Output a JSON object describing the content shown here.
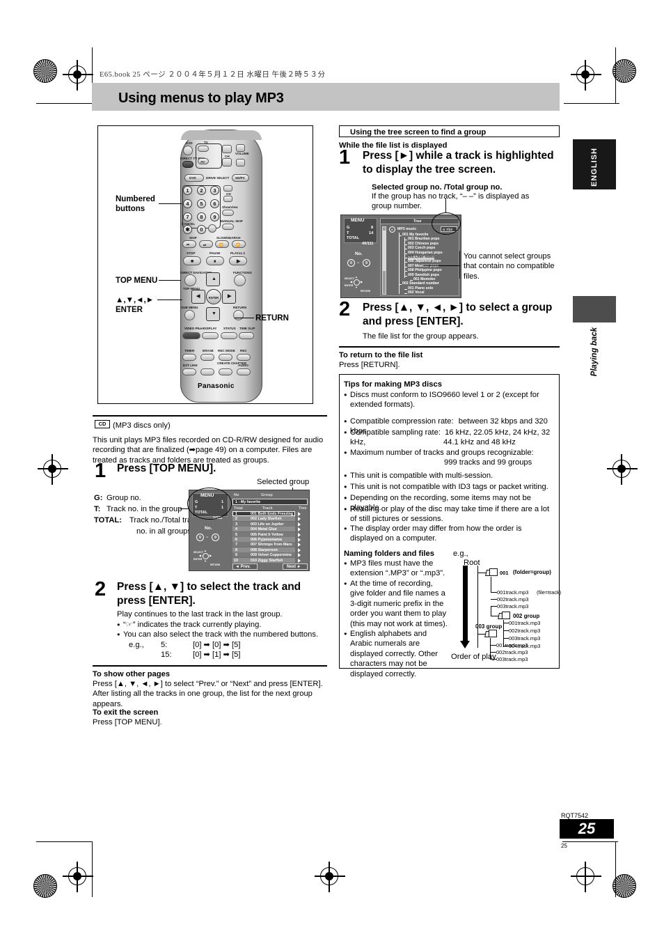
{
  "meta": {
    "bookline": "E65.book  25 ページ  ２００４年５月１２日  水曜日  午後２時５３分",
    "page_title": "Using menus to play MP3",
    "manual_code": "RQT7542",
    "page_number": "25",
    "page_number_small": "25",
    "side_tab_language": "ENGLISH",
    "side_tab_section": "Playing back"
  },
  "remote": {
    "labels": {
      "dvd": "DVD",
      "tv": "TV",
      "direct_tv_rec": "DIRECT TV REC",
      "av": "AV",
      "ch": "CH",
      "volume": "VOLUME",
      "drive_select": "DRIVE SELECT",
      "dvd_btn": "DVD",
      "sd_pc": "SD/PC",
      "showview": "ShowView",
      "cancel": "CANCEL",
      "manual_skip": "MANUAL SKIP",
      "skip": "SKIP",
      "slow_search": "SLOW/SEARCH",
      "stop": "STOP",
      "pause": "PAUSE",
      "play": "PLAYx1.3",
      "direct_navigator": "DIRECT NAVIGATOR",
      "top_menu": "TOP MENU",
      "functions": "FUNCTIONS",
      "enter": "ENTER",
      "sub_menu": "SUB MENU",
      "return": "RETURN",
      "videoplus": "VIDEO Plus+",
      "display": "DISPLAY",
      "status": "STATUS",
      "time_slip": "TIME SLIP",
      "timer": "TIMER",
      "erase": "ERASE",
      "rec_mode": "REC MODE",
      "rec": "REC",
      "ext_link": "EXT LINK",
      "create_chapter": "CREATE CHAPTER",
      "audio": "AUDIO",
      "brand": "Panasonic"
    },
    "number_keys": [
      "1",
      "2",
      "3",
      "4",
      "5",
      "6",
      "7",
      "8",
      "9",
      "0"
    ],
    "callouts": {
      "numbered_buttons": "Numbered\nbuttons",
      "top_menu": "TOP MENU",
      "arrows_enter": "▲,▼,◄,►\nENTER",
      "return": "RETURN"
    }
  },
  "left_column": {
    "cd_tag": "CD",
    "cd_note": "(MP3 discs only)",
    "intro": "This unit plays MP3 files recorded on CD-R/RW designed for audio recording that are finalized (➡page 49) on a computer. Files are treated as tracks and folders are treated as groups.",
    "step1_num": "1",
    "step1_head": "Press [TOP MENU].",
    "selected_group_caption": "Selected group",
    "legend": [
      {
        "key": "G:",
        "text": "Group no."
      },
      {
        "key": "T:",
        "text": "Track no. in the group"
      },
      {
        "key": "TOTAL:",
        "text": "Track no./Total track"
      },
      {
        "key": "",
        "text": "no. in all groups"
      }
    ],
    "step2_num": "2",
    "step2_head": "Press [▲, ▼] to select the track and press [ENTER].",
    "step2_body": "Play continues to the last track in the last group.",
    "step2_bullets": [
      "“☞” indicates the track currently playing.",
      "You can also select the track with the numbered buttons."
    ],
    "eg_label": "e.g.,",
    "eg_rows": [
      {
        "n": "5:",
        "seq": "[0] ➡ [0] ➡ [5]"
      },
      {
        "n": "15:",
        "seq": "[0] ➡ [1] ➡ [5]"
      }
    ],
    "other_pages_head": "To show other pages",
    "other_pages_body": "Press [▲, ▼, ◄, ►] to select “Prev.” or “Next” and press [ENTER]. After listing all the tracks in one group, the list for the next group appears.",
    "exit_head": "To exit the screen",
    "exit_body": "Press [TOP MENU]."
  },
  "file_list_screen": {
    "menu_label": "MENU",
    "g_label": "G",
    "g_value": "1",
    "t_label": "T",
    "t_value": "1",
    "total_label": "TOTAL",
    "total_value": "1/111",
    "no_label": "No.",
    "no_keys": [
      "0",
      "9"
    ],
    "no_dash": "~",
    "pad_select": "SELECT",
    "pad_enter": "ENTER",
    "pad_return": "RETURN",
    "col_no": "No",
    "col_group": "Group",
    "group_row": "1  :  My favorite",
    "col_total": "Total",
    "col_track": "Track",
    "col_tree": "Tree",
    "tracks": [
      {
        "total": "1",
        "track": "001 Both Ends Freezing"
      },
      {
        "total": "2",
        "track": "002 Lady Starfish"
      },
      {
        "total": "3",
        "track": "003 Life on Jupiter"
      },
      {
        "total": "4",
        "track": "004 Metal Glue"
      },
      {
        "total": "5",
        "track": "005 Paint It Yellow"
      },
      {
        "total": "6",
        "track": "006 Pyjamamama"
      },
      {
        "total": "7",
        "track": "007 Shrimps from Mars"
      },
      {
        "total": "8",
        "track": "008 Starperson"
      },
      {
        "total": "9",
        "track": "009 Velvet Cuppermine"
      },
      {
        "total": "10",
        "track": "010 Ziggy Starfish"
      }
    ],
    "prev_label": "◄ Prev.",
    "next_label": "Next ►"
  },
  "right_column": {
    "section_head": "Using the tree screen to find a group",
    "precondition": "While the file list is displayed",
    "step1_num": "1",
    "step1_head": "Press [►] while a track is highlighted to display the tree screen.",
    "step1_caption_bold": "Selected group no. /Total group no.",
    "step1_caption_body": "If the group has no track, “– –” is displayed as group number.",
    "tree_note": "You cannot select groups that contain no compatible files.",
    "step2_num": "2",
    "step2_head": "Press [▲, ▼, ◄, ►] to select a group and press [ENTER].",
    "step2_body": "The file list for the group appears.",
    "return_head": "To return to the file list",
    "return_body": "Press [RETURN]."
  },
  "tree_screen": {
    "menu_label": "MENU",
    "g_label": "G",
    "g_value": "8",
    "t_label": "T",
    "t_value": "14",
    "total_label": "TOTAL",
    "total_value": "40/111",
    "no_label": "No.",
    "no_keys": [
      "0",
      "9"
    ],
    "no_dash": "~",
    "header": "Tree",
    "group_badge": "G  7/23",
    "root": "MP3 music",
    "items": [
      {
        "label": "001 My favorite",
        "level": 1,
        "highlight": false
      },
      {
        "label": "001 Brazilian pops",
        "level": 2,
        "highlight": false
      },
      {
        "label": "002 Chinese pops",
        "level": 2,
        "highlight": false
      },
      {
        "label": "003 Czech pops",
        "level": 2,
        "highlight": false
      },
      {
        "label": "004 Hungarian pops",
        "level": 2,
        "highlight": false
      },
      {
        "label": "005 Liner notes",
        "level": 2,
        "highlight": true
      },
      {
        "label": "006 Japanese pops",
        "level": 2,
        "highlight": false
      },
      {
        "label": "007 Mexican pops",
        "level": 2,
        "highlight": false
      },
      {
        "label": "008 Philippine pops",
        "level": 2,
        "highlight": false
      },
      {
        "label": "009 Swedish pops",
        "level": 2,
        "highlight": false
      },
      {
        "label": "001 Momoko",
        "level": 3,
        "highlight": false
      },
      {
        "label": "002 Standard number",
        "level": 1,
        "highlight": false
      },
      {
        "label": "001 Piano solo",
        "level": 2,
        "highlight": false
      },
      {
        "label": "002 Vocal",
        "level": 2,
        "highlight": false
      }
    ]
  },
  "tips_box": {
    "head": "Tips for making MP3 discs",
    "bullets_top": [
      "Discs must conform to ISO9660 level 1 or 2 (except for extended formats)."
    ],
    "rate_bullets": [
      {
        "label": "Compatible compression rate:",
        "value": "between 32 kbps and 320 kbps"
      },
      {
        "label": "Compatible sampling rate:",
        "value": "16 kHz, 22.05 kHz, 24 kHz, 32 kHz,",
        "value2": "44.1 kHz and 48 kHz"
      },
      {
        "label": "Maximum number of tracks and groups recognizable:",
        "value": "999 tracks and 99 groups"
      }
    ],
    "bullets_bottom": [
      "This unit is compatible with multi-session.",
      "This unit is not compatible with ID3 tags or packet writing.",
      "Depending on the recording, some items may not be playable.",
      "Reading or play of the disc may take time if there are a lot of still pictures or sessions.",
      "The display order may differ from how the order is displayed on a computer."
    ],
    "naming_head": "Naming folders and files",
    "naming_bullets": [
      "MP3 files must have the extension “.MP3” or “.mp3”.",
      "At the time of recording, give folder and file names a 3-digit numeric prefix in the order you want them to play (this may not work at times).",
      "English alphabets and Arabic numerals are displayed correctly. Other characters may not be displayed correctly."
    ]
  },
  "folder_diagram": {
    "eg": "e.g.,",
    "root": "Root",
    "order_of_play": "Order of play",
    "group1_num": "001",
    "group1_note": "(folder=group)",
    "group1_files": [
      {
        "name": "001track.mp3",
        "note": "(file=track)"
      },
      {
        "name": "002track.mp3",
        "note": ""
      },
      {
        "name": "003track.mp3",
        "note": ""
      }
    ],
    "group2_label": "002 group",
    "group2_files": [
      "001track.mp3",
      "002track.mp3",
      "003track.mp3",
      "004track.mp3"
    ],
    "group3_label": "003 group",
    "group3_files": [
      "001track.mp3",
      "002track.mp3",
      "003track.mp3"
    ]
  }
}
